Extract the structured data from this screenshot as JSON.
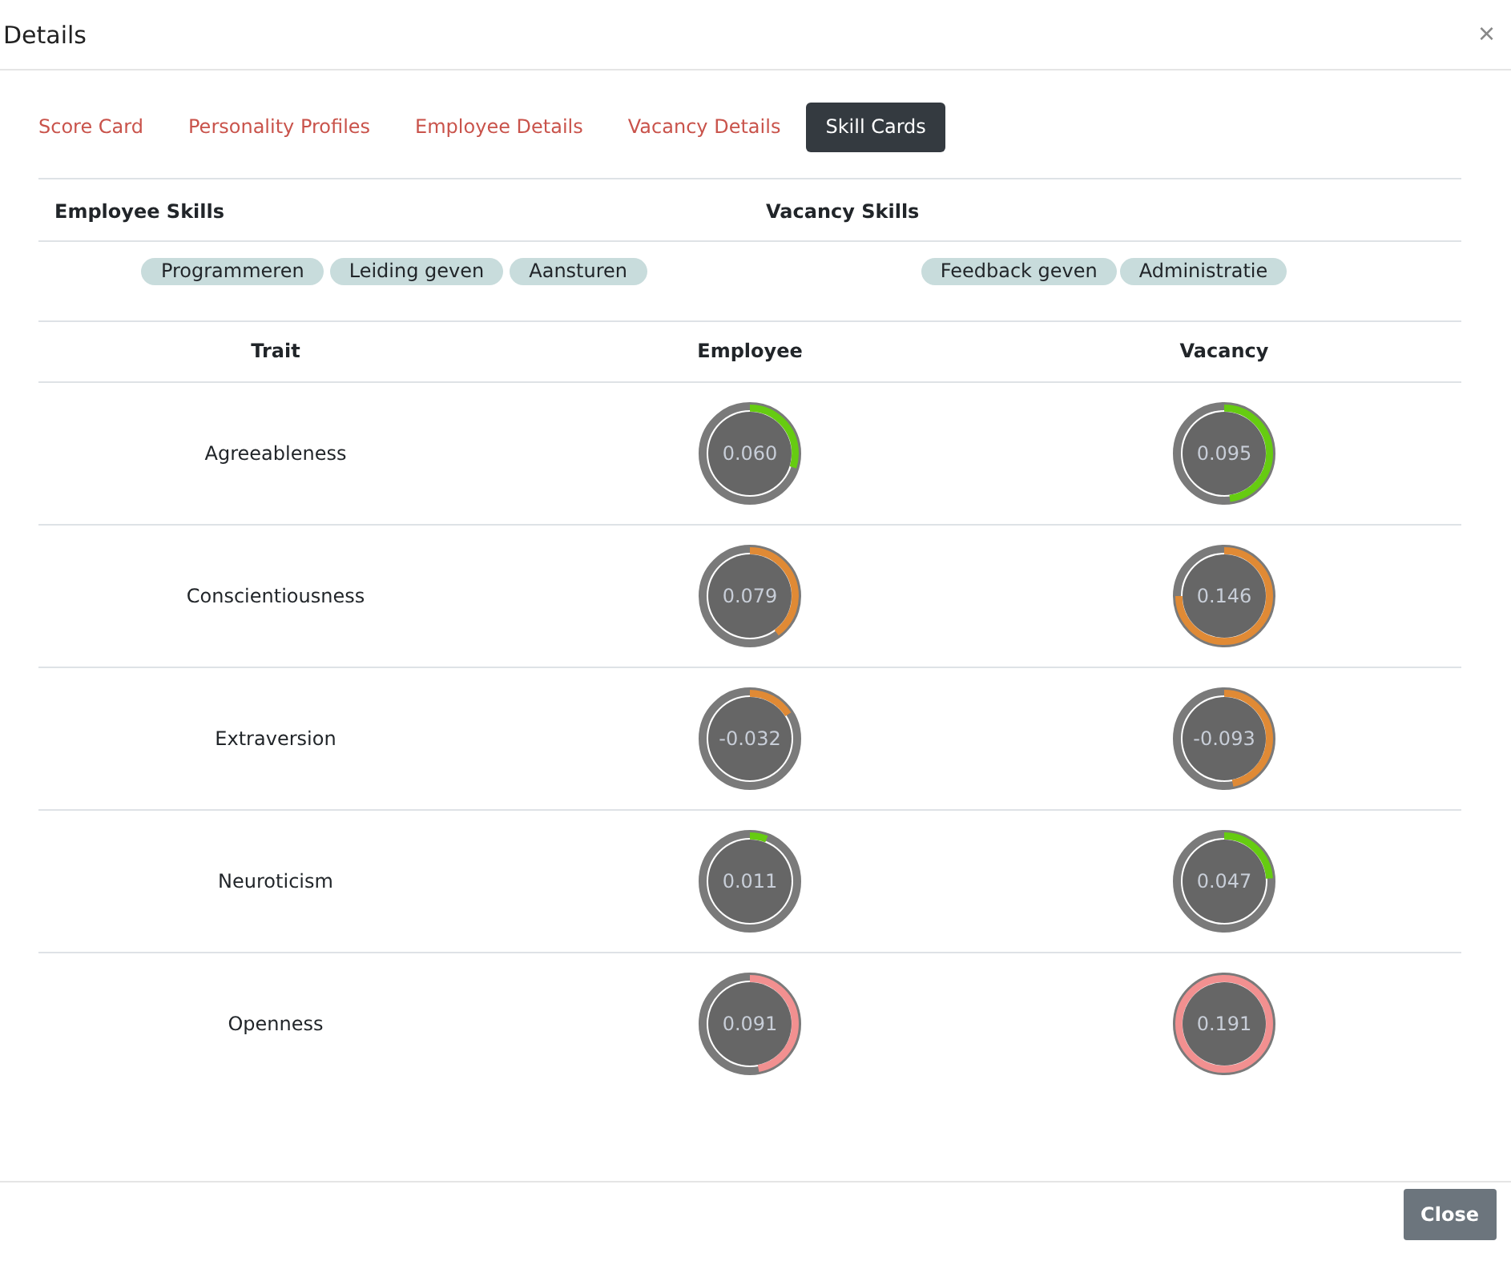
{
  "window": {
    "title": "Details",
    "close": "×"
  },
  "tabs": [
    {
      "label": "Score Card",
      "selected": false
    },
    {
      "label": "Personality Profiles",
      "selected": false
    },
    {
      "label": "Employee Details",
      "selected": false
    },
    {
      "label": "Vacancy Details",
      "selected": false
    },
    {
      "label": "Skill Cards",
      "selected": true
    }
  ],
  "skills": {
    "employee_heading": "Employee Skills",
    "vacancy_heading": "Vacancy Skills",
    "employee": [
      "Programmeren",
      "Leiding geven",
      "Aansturen"
    ],
    "vacancy": [
      "Feedback geven",
      "Administratie"
    ]
  },
  "traits": {
    "columns": [
      "Trait",
      "Employee",
      "Vacancy"
    ],
    "rows": [
      {
        "name": "Agreeableness",
        "color": "#66cc11",
        "employee": {
          "reading": "0.060",
          "level": 0.3
        },
        "vacancy": {
          "reading": "0.095",
          "level": 0.48
        }
      },
      {
        "name": "Conscientiousness",
        "color": "#e08a35",
        "employee": {
          "reading": "0.079",
          "level": 0.4
        },
        "vacancy": {
          "reading": "0.146",
          "level": 0.75
        }
      },
      {
        "name": "Extraversion",
        "color": "#e08a35",
        "employee": {
          "reading": "-0.032",
          "level": 0.16
        },
        "vacancy": {
          "reading": "-0.093",
          "level": 0.47
        }
      },
      {
        "name": "Neuroticism",
        "color": "#66cc11",
        "employee": {
          "reading": "0.011",
          "level": 0.06
        },
        "vacancy": {
          "reading": "0.047",
          "level": 0.24
        }
      },
      {
        "name": "Openness",
        "color": "#f29090",
        "employee": {
          "reading": "0.091",
          "level": 0.47
        },
        "vacancy": {
          "reading": "0.191",
          "level": 1
        }
      }
    ]
  },
  "footer": {
    "close_button": "Close"
  }
}
